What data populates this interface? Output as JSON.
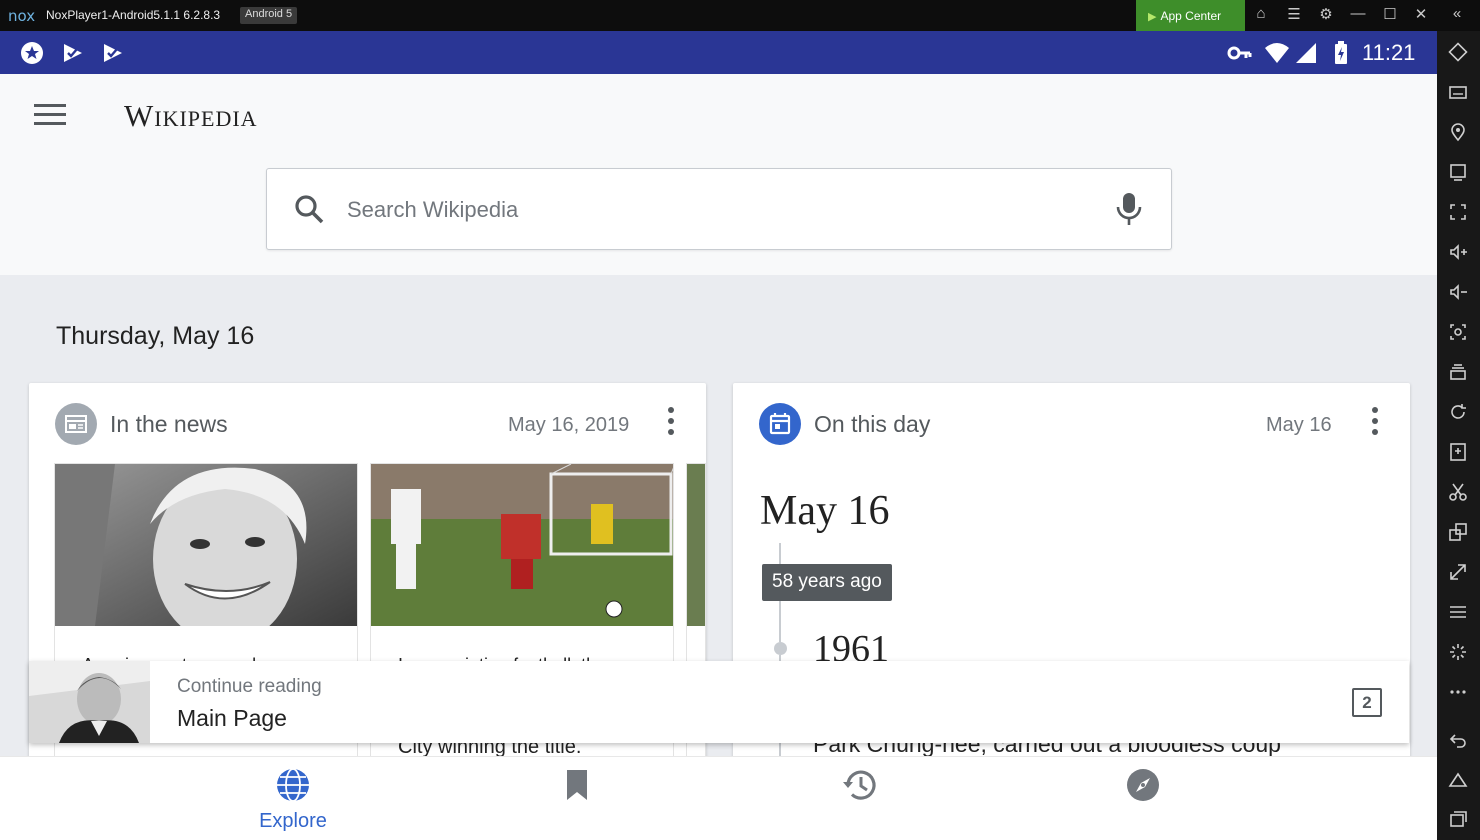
{
  "window": {
    "logo": "nox",
    "title": "NoxPlayer1-Android5.1.1 6.2.8.3",
    "badge": "Android 5",
    "app_center": "App Center"
  },
  "statusbar": {
    "time": "11:21",
    "left_icons": [
      "app-star-icon",
      "task-check-icon",
      "task-check-icon"
    ],
    "right_icons": [
      "vpn-key-icon",
      "wifi-icon",
      "signal-icon",
      "battery-charging-icon"
    ]
  },
  "header": {
    "wordmark": "Wikipedia",
    "search": {
      "placeholder": "Search Wikipedia",
      "value": ""
    }
  },
  "feed": {
    "date_heading": "Thursday, May 16",
    "news_card": {
      "title": "In the news",
      "date": "May 16, 2019",
      "items": [
        {
          "text": "American actress and"
        },
        {
          "text": "In association football, the"
        }
      ],
      "behind_text": "City winning the title."
    },
    "on_this_day_card": {
      "title": "On this day",
      "date": "May 16",
      "day": "May 16",
      "years_ago": "58 years ago",
      "year": "1961",
      "behind_text": "Park Chung-hee, carried out a bloodless coup"
    }
  },
  "continue_reading": {
    "label": "Continue reading",
    "title": "Main Page",
    "tab_count": "2"
  },
  "bottom_nav": {
    "items": [
      {
        "label": "Explore",
        "icon": "globe-icon",
        "active": true
      },
      {
        "label": "",
        "icon": "bookmark-icon",
        "active": false
      },
      {
        "label": "",
        "icon": "history-icon",
        "active": false
      },
      {
        "label": "",
        "icon": "compass-icon",
        "active": false
      }
    ]
  },
  "colors": {
    "statusbar": "#2a3695",
    "accent": "#3366cc",
    "app_center": "#3e8e2a"
  }
}
